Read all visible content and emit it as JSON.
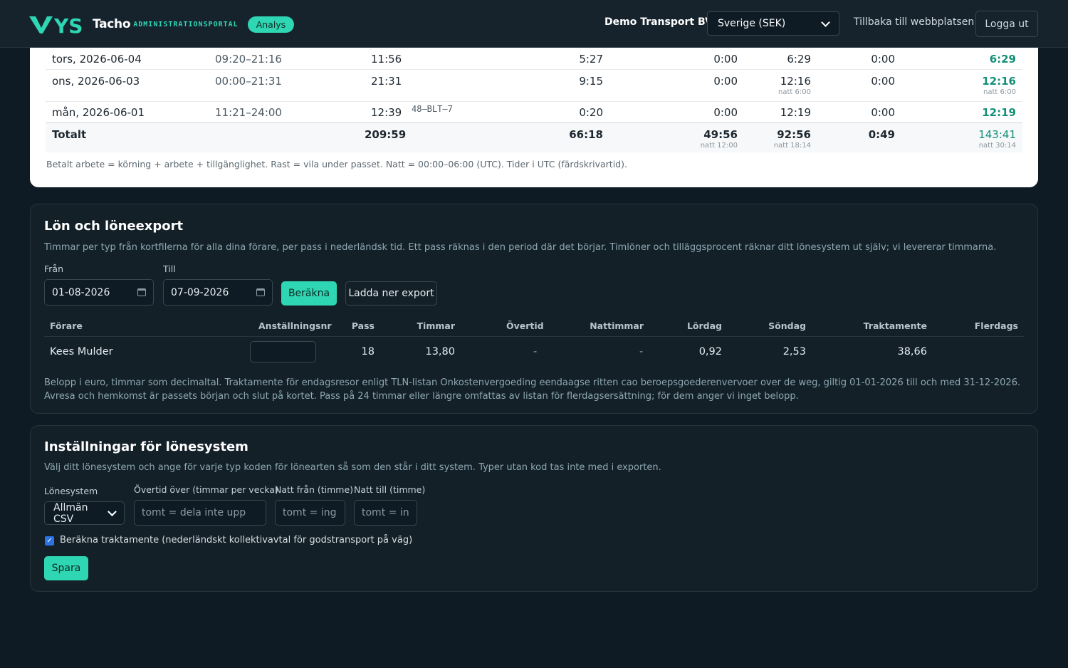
{
  "header": {
    "brand_logo": "YS",
    "brand": "Tacho",
    "brand_sub": "ADMINISTRATIONSPORTAL",
    "analys_badge": "Analys",
    "company": "Demo Transport BV",
    "country_select": "Sverige (SEK)",
    "back_link": "Tillbaka till webbplatsen",
    "logout": "Logga ut"
  },
  "daily": {
    "rows": [
      {
        "date": "tors, 2026-06-04",
        "time": "09:20–21:16",
        "total": "11:56",
        "plate": "",
        "rest": "5:27",
        "night_rest": "0:00",
        "paid": "6:29",
        "paid_sub": "",
        "overtime": "0:00",
        "sum": "6:29",
        "sum_sub": ""
      },
      {
        "date": "ons, 2026-06-03",
        "time": "00:00–21:31",
        "total": "21:31",
        "plate": "",
        "rest": "9:15",
        "night_rest": "0:00",
        "paid": "12:16",
        "paid_sub": "natt 6:00",
        "overtime": "0:00",
        "sum": "12:16",
        "sum_sub": "natt 6:00"
      },
      {
        "date": "mån, 2026-06-01",
        "time": "11:21–24:00",
        "total": "12:39",
        "plate": "48–BLT–7",
        "rest": "0:20",
        "night_rest": "0:00",
        "paid": "12:19",
        "paid_sub": "",
        "overtime": "0:00",
        "sum": "12:19",
        "sum_sub": ""
      }
    ],
    "totals": {
      "label": "Totalt",
      "total": "209:59",
      "rest": "66:18",
      "night_rest": "49:56",
      "night_rest_sub": "natt 12:00",
      "paid": "92:56",
      "paid_sub": "natt 18:14",
      "overtime": "0:49",
      "sum": "143:41",
      "sum_sub": "natt 30:14"
    },
    "note": "Betalt arbete = körning + arbete + tillgänglighet. Rast = vila under passet. Natt = 00:00–06:00 (UTC). Tider i UTC (färdskrivartid)."
  },
  "payroll": {
    "title": "Lön och löneexport",
    "description": "Timmar per typ från kortfilerna för alla dina förare, per pass i nederländsk tid. Ett pass räknas i den period där det börjar. Timlöner och tilläggsprocent räknar ditt lönesystem ut själv; vi levererar timmarna.",
    "from_label": "Från",
    "from_value": "01-08-2026",
    "to_label": "Till",
    "to_value": "07-09-2026",
    "calculate_btn": "Beräkna",
    "export_btn": "Ladda ner export",
    "columns": [
      "Förare",
      "Anställningsnr",
      "Pass",
      "Timmar",
      "Övertid",
      "Nattimmar",
      "Lördag",
      "Söndag",
      "Traktamente",
      "Flerdags"
    ],
    "rows": [
      {
        "driver": "Kees Mulder",
        "emp_no": "",
        "pass": "18",
        "hours": "13,80",
        "overtime": "-",
        "night": "-",
        "saturday": "0,92",
        "sunday": "2,53",
        "allowance": "38,66",
        "multi": ""
      }
    ],
    "note": "Belopp i euro, timmar som decimaltal. Traktamente för endagsresor enligt TLN-listan Onkostenvergoeding eendaagse ritten cao beroepsgoederenvervoer over de weg, giltig 01-01-2026 till och med 31-12-2026. Avresa och hemkomst är passets början och slut på kortet. Pass på 24 timmar eller längre omfattas av listan för flerdagsersättning; för dem anger vi inget belopp."
  },
  "settings": {
    "title": "Inställningar för lönesystem",
    "description": "Välj ditt lönesystem och ange för varje typ koden för lönearten så som den står i ditt system. Typer utan kod tas inte med i exporten.",
    "system_label": "Lönesystem",
    "system_value": "Allmän CSV",
    "overtime_label": "Övertid över (timmar per vecka)",
    "overtime_placeholder": "tomt = dela inte upp",
    "night_from_label": "Natt från (timme)",
    "night_from_placeholder": "tomt = ing",
    "night_to_label": "Natt till (timme)",
    "night_to_placeholder": "tomt = in",
    "allowance_checkbox_label": "Beräkna traktamente (nederländskt kollektivavtal för godstransport på väg)",
    "allowance_checked": true,
    "save_btn": "Spara"
  },
  "colors": {
    "accent": "#2fd6b3",
    "background": "#0f1b24",
    "card": "#132028",
    "total_green": "#138f78"
  }
}
